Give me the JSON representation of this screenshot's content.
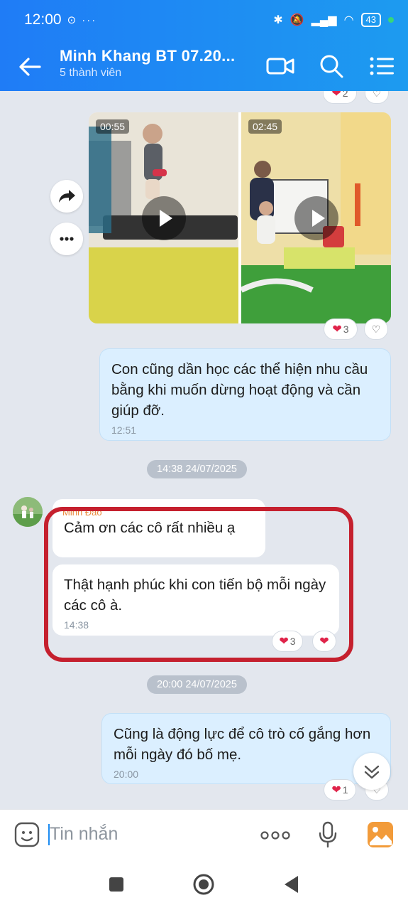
{
  "status_bar": {
    "time": "12:00",
    "icons_left": "⊙ ···",
    "battery": "43"
  },
  "header": {
    "title": "Minh Khang BT 07.20...",
    "subtitle": "5 thành viên"
  },
  "messages": {
    "top_reaction_count": "2",
    "videos": [
      {
        "duration": "00:55"
      },
      {
        "duration": "02:45"
      }
    ],
    "video_reaction_count": "3",
    "msg1": {
      "text": "Con cũng dần học các thể hiện nhu cầu bằng khi muốn dừng hoạt động và cần giúp đỡ.",
      "time": "12:51"
    },
    "divider1": "14:38 24/07/2025",
    "sender_name": "Minh Đào",
    "msg2": {
      "text": "Cảm ơn các cô rất nhiều ạ"
    },
    "msg3": {
      "text": "Thật hạnh phúc khi con tiến bộ mỗi ngày các cô à.",
      "time": "14:38"
    },
    "msg3_reaction_count": "3",
    "divider2": "20:00 24/07/2025",
    "msg4": {
      "text": "Cũng là động lực để cô trò cố gắng hơn mỗi ngày đó bố mẹ.",
      "time": "20:00"
    },
    "msg4_reaction_count": "1"
  },
  "input": {
    "placeholder": "Tin nhắn"
  },
  "colors": {
    "header": "#1f7cf6",
    "my_bubble": "#dbefff",
    "highlight": "#c5202e",
    "heart": "#e0244a"
  }
}
